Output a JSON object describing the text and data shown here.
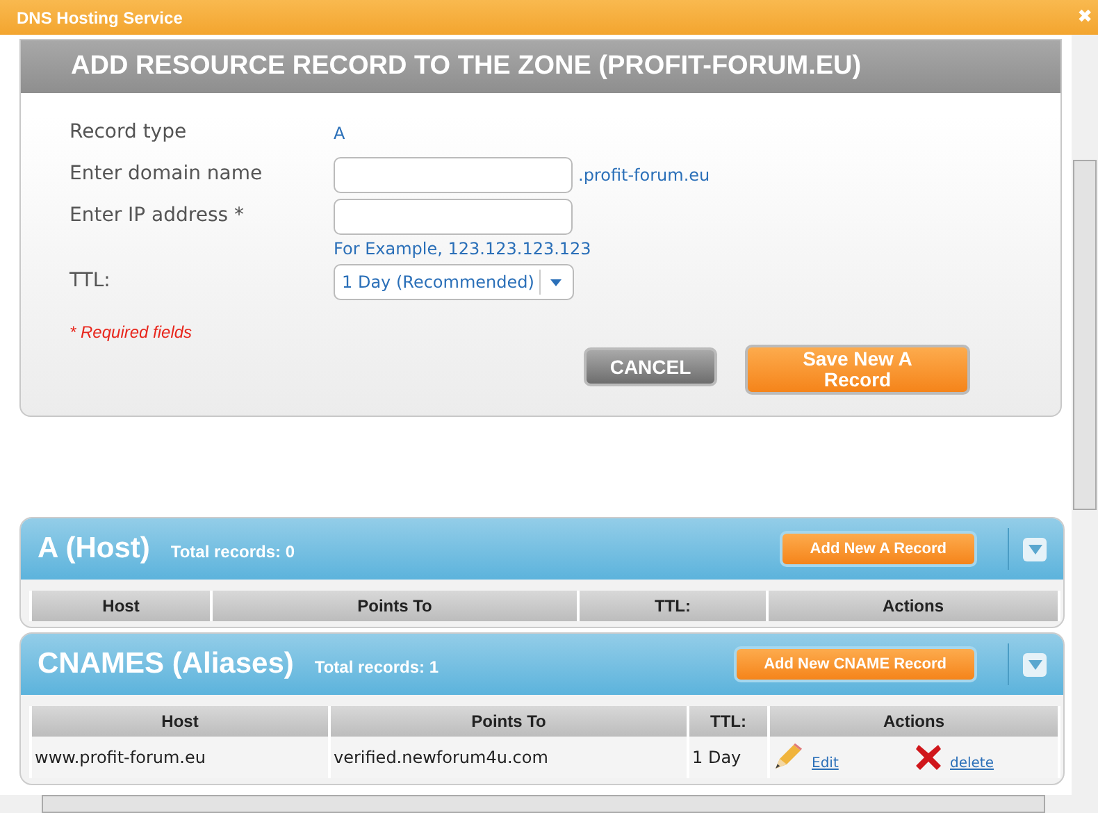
{
  "window": {
    "title": "DNS Hosting Service",
    "close": "✖"
  },
  "form": {
    "heading": "ADD RESOURCE RECORD TO THE ZONE (PROFIT-FORUM.EU)",
    "fields": [
      {
        "kind": "static",
        "label": "Record type",
        "value": "A"
      },
      {
        "kind": "input",
        "label": "Enter domain name",
        "suffix": ".profit-forum.eu"
      },
      {
        "kind": "input",
        "label": "Enter IP address *",
        "hint": "For Example, 123.123.123.123"
      },
      {
        "kind": "select",
        "label": "TTL:",
        "value": "1 Day (Recommended)"
      }
    ],
    "required_note": "* Required fields",
    "buttons": [
      {
        "kind": "cancel",
        "label": "CANCEL"
      },
      {
        "kind": "primary",
        "label": "Save New A Record"
      }
    ]
  },
  "sections": [
    {
      "title": "A (Host)",
      "total": "Total records: 0",
      "add_button": "Add New A Record",
      "columns": [
        "Host",
        "Points To",
        "TTL:",
        "Actions"
      ]
    },
    {
      "title": "CNAMES (Aliases)",
      "total": "Total records: 1",
      "add_button": "Add New CNAME Record",
      "columns": [
        "Host",
        "Points To",
        "TTL:",
        "Actions"
      ],
      "rows": [
        {
          "cells": [
            "www.profit-forum.eu",
            "verified.newforum4u.com",
            "1 Day"
          ],
          "actions": [
            {
              "kind": "edit",
              "label": "Edit"
            },
            {
              "kind": "delete",
              "label": "delete"
            }
          ]
        }
      ]
    }
  ]
}
